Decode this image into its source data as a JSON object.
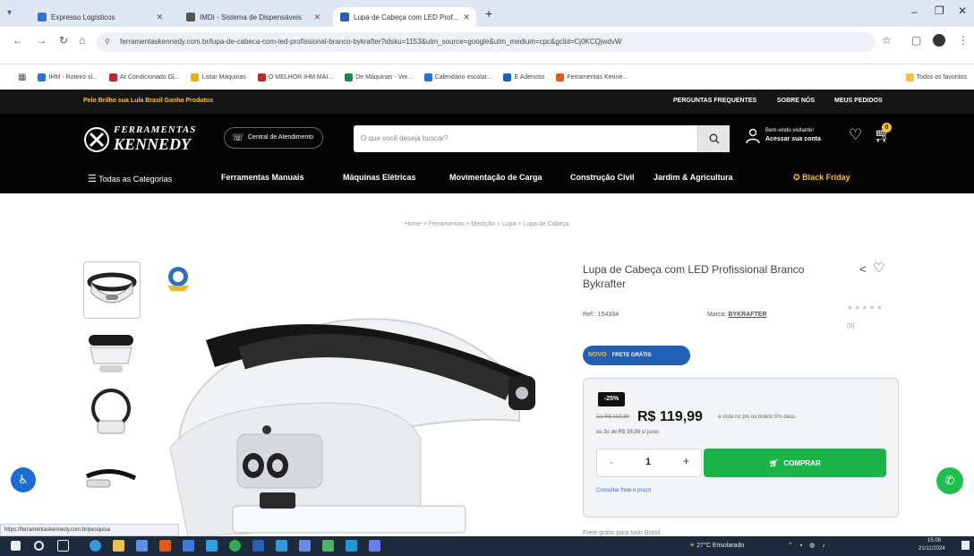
{
  "browser": {
    "tabs": [
      {
        "title": "Expresso Logísticos",
        "favicon_color": "#2f6fd6"
      },
      {
        "title": "IMDI - Sistema de Dispensáveis",
        "favicon_color": "#555555"
      },
      {
        "title": "Lupa de Cabeça com LED Prof...",
        "favicon_color": "#1f5fb6"
      }
    ],
    "new_tab_label": "+",
    "url": "ferramentaskennedy.com.br/lupa-de-cabeca-com-led-profissional-branco-bykrafter?idsku=1153&utm_source=google&utm_medium=cpc&gclid=Cj0KCQjwdvW",
    "bookmarks": [
      {
        "label": "IHM - Roteiro sl...",
        "color": "#2f6fd6"
      },
      {
        "label": "Ar Condicionado Gl...",
        "color": "#c0262d"
      },
      {
        "label": "Listar Máquinas",
        "color": "#e2b300"
      },
      {
        "label": "O MELHOR IHM MAI...",
        "color": "#c0262d"
      },
      {
        "label": "De Máquinas - Ver...",
        "color": "#1f8a4a"
      },
      {
        "label": "Calendário escolar...",
        "color": "#2f6fd6"
      },
      {
        "label": "E Adenoso",
        "color": "#1f5fb6"
      },
      {
        "label": "Ferramentas Kenne...",
        "color": "#e55a12"
      }
    ],
    "bookmarks_right": "Todos os favoritos",
    "status_url": "https://ferramentaskennedy.com.br/pesquisa"
  },
  "site": {
    "top_strip_left": "Pelo Brilho sua Lula Brasil Ganha Produtos",
    "top_links": [
      "PERGUNTAS FREQUENTES",
      "SOBRE NÓS",
      "MEUS PEDIDOS"
    ],
    "logo_line1": "FERRAMENTAS",
    "logo_line2": "KENNEDY",
    "central_button": "Central de Atendimento",
    "search_placeholder": "O que você deseja buscar?",
    "account_line1": "Bem-vindo visitante!",
    "account_line2": "Acessar sua conta",
    "cart_count": "0",
    "categories": [
      "Todas as Categorias",
      "Ferramentas Manuais",
      "Máquinas Elétricas",
      "Movimentação de Carga",
      "Construção Civil",
      "Jardim & Agricultura",
      "Black Friday"
    ],
    "breadcrumb": "Home > Ferramentas > Medição > Lupa > Lupa de Cabeça"
  },
  "product": {
    "title": "Lupa de Cabeça com LED Profissional Branco Bykrafter",
    "ref": "Ref.: 154334",
    "brand_label": "Marca:",
    "brand": "BYKRAFTER",
    "rating_count": "(0)",
    "badge_text": "NOVO",
    "badge_sub": "FRETE GRÁTIS",
    "discount": "-25%",
    "old_price_label": "De R$ 159,99",
    "price": "R$ 119,99",
    "price_note": "à vista no pix ou boleto 5% desc.",
    "installments": "ou 3x de R$ 39,99 s/ juros",
    "quantity": "1",
    "qty_minus": "-",
    "qty_plus": "+",
    "buy_label": "COMPRAR",
    "shipping_link": "Consultar frete e prazo",
    "below_box": "Frete grátis para todo Brasil"
  },
  "taskbar": {
    "weather": "27°C Ensolarado",
    "time": "15:08",
    "date": "21/11/2024"
  }
}
